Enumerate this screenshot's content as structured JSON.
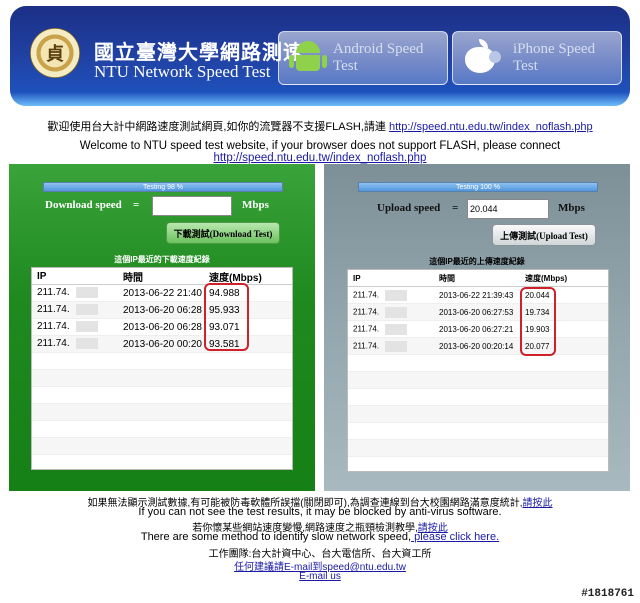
{
  "header": {
    "seal_glyph": "貞",
    "title_cn": "國立臺灣大學網路測速",
    "title_en": "NTU Network Speed Test",
    "android_label": "Android Speed Test",
    "iphone_label": "iPhone Speed Test",
    "android_icon": "android-icon",
    "apple_icon": "apple-icon"
  },
  "notice": {
    "cn_text": "歡迎使用台大計中網路速度測試網頁,如你的流覽器不支援FLASH,請連",
    "en_text": "Welcome to NTU speed test website, if your browser does not support FLASH, please connect",
    "link": "http://speed.ntu.edu.tw/index_noflash.php"
  },
  "download": {
    "progress_text": "Testing 98 %",
    "progress": 0.98,
    "label": "Download speed",
    "equals": "=",
    "value": "",
    "unit": "Mbps",
    "button": "下載測試(Download Test)",
    "records_title": "這個IP最近的下載速度紀錄",
    "columns": [
      "IP",
      "時間",
      "速度(Mbps)"
    ],
    "rows": [
      {
        "ip": "211.74.",
        "time": "2013-06-22 21:40",
        "speed": "94.988"
      },
      {
        "ip": "211.74.",
        "time": "2013-06-20 06:28",
        "speed": "95.933"
      },
      {
        "ip": "211.74.",
        "time": "2013-06-20 06:28",
        "speed": "93.071"
      },
      {
        "ip": "211.74.",
        "time": "2013-06-20 00:20",
        "speed": "93.581"
      }
    ]
  },
  "upload": {
    "progress_text": "Testing 100 %",
    "progress": 1.0,
    "label": "Upload speed",
    "equals": "=",
    "value": "20.044",
    "unit": "Mbps",
    "button": "上傳測試(Upload Test)",
    "records_title": "這個IP最近的上傳速度紀錄",
    "columns": [
      "IP",
      "時間",
      "速度(Mbps)"
    ],
    "rows": [
      {
        "ip": "211.74.",
        "time": "2013-06-22 21:39:43",
        "speed": "20.044"
      },
      {
        "ip": "211.74.",
        "time": "2013-06-20 06:27:53",
        "speed": "19.734"
      },
      {
        "ip": "211.74.",
        "time": "2013-06-20 06:27:21",
        "speed": "19.903"
      },
      {
        "ip": "211.74.",
        "time": "2013-06-20 00:20:14",
        "speed": "20.077"
      }
    ]
  },
  "footer": {
    "line1": "如果無法顯示測試數據,有可能被防毒軟體所誤擋(關閉即可),為調查連線到台大校園網路滿意度統計,",
    "line1_link": "請按此",
    "line2": "If you can not see the test results, it may be blocked by anti-virus software.",
    "line3": "若你懷某些網站速度變慢,網路速度之瓶頸檢測教學,",
    "line3_link": "請按此",
    "line4": "There are some method to identify slow network speed,",
    "line4_link": " please click here.",
    "line5": "工作團隊:台大計資中心、台大電信所、台大資工所",
    "line6_link": "任何建議請E-mail到speed@ntu.edu.tw",
    "line7_link": "E-mail us"
  },
  "watermark": "#1818761"
}
